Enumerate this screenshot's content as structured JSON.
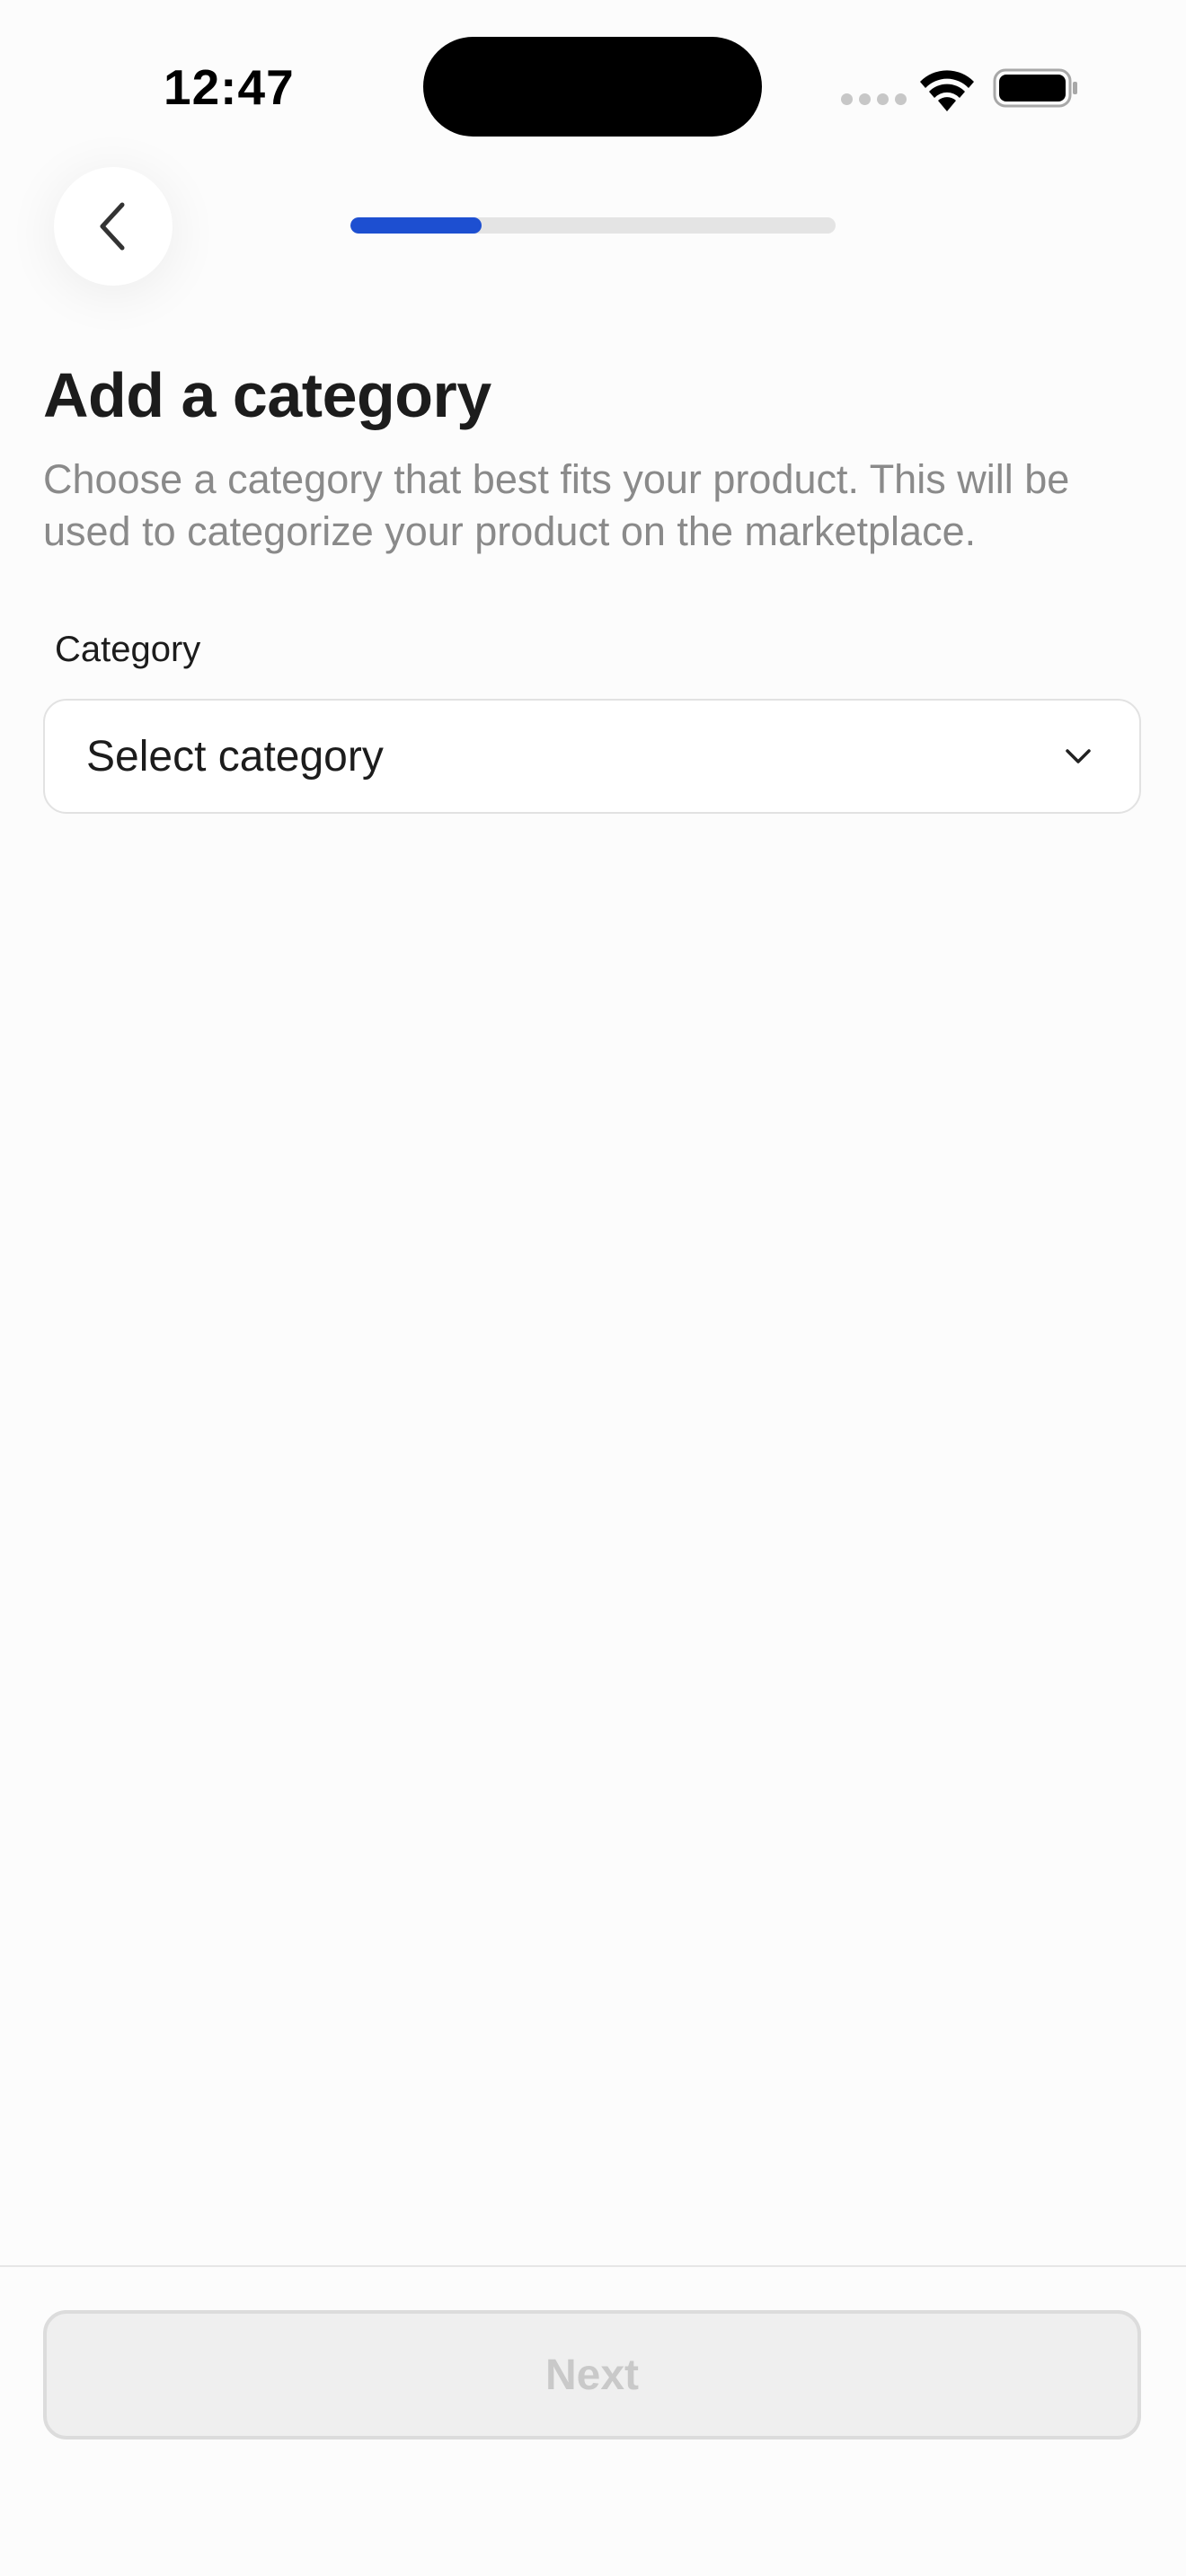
{
  "status_bar": {
    "time": "12:47",
    "icons": [
      "signal-dots-icon",
      "wifi-icon",
      "battery-icon"
    ]
  },
  "header": {
    "back_icon": "chevron-left-icon",
    "progress": 0.27,
    "progress_color": "#1d4fd1"
  },
  "main": {
    "title": "Add a category",
    "subtitle": "Choose a category that best fits your product. This will be used to categorize your product on the marketplace.",
    "category_field": {
      "label": "Category",
      "value": "Select category",
      "icon": "chevron-down-icon"
    }
  },
  "footer": {
    "next_label": "Next",
    "next_enabled": false
  }
}
